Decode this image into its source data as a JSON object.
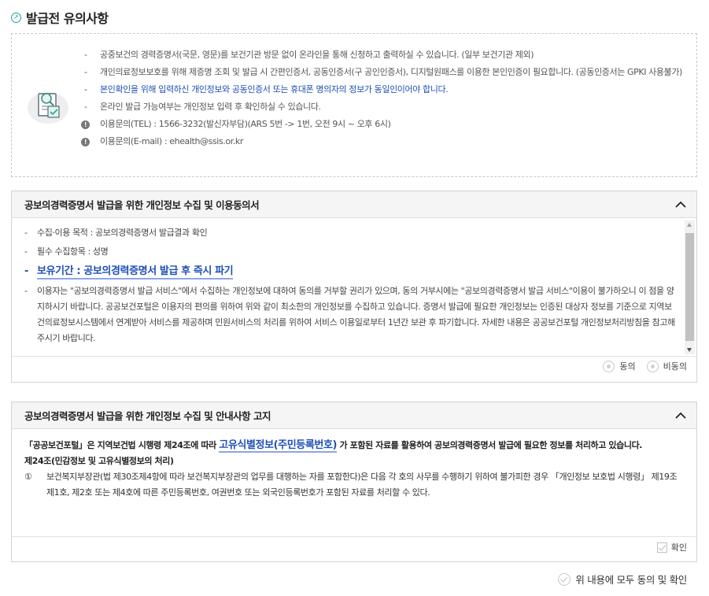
{
  "header": {
    "title": "발급전 유의사항",
    "icon": "compass-icon"
  },
  "notice": {
    "items": [
      "공중보건의 경력증명서(국문, 영문)를 보건기관 방문 없이 온라인을 통해 신청하고 출력하실 수 있습니다. (일부 보건기관 제외)",
      "개인의료정보보호를 위해 제증명 조회 및 발급 시 간편인증서, 공동인증서(구 공인인증서), 디지털원패스를 이용한 본인인증이 필요합니다. (공동인증서는 GPKI 사용불가)",
      "본인확인을 위해 입력하신 개인정보와 공동인증서 또는 휴대폰 명의자의 정보가 동일인이어야 합니다.",
      "온라인 발급 가능여부는 개인정보 입력 후 확인하실 수 있습니다."
    ],
    "contacts": [
      "이용문의(TEL) : 1566-3232(발신자부담)(ARS 5번 -> 1번, 오전 9시 ~ 오후 6시)",
      "이용문의(E-mail) : ehealth@ssis.or.kr"
    ],
    "dash": "-",
    "highlight_color": "#1f4fb5"
  },
  "consent": {
    "title": "공보의경력증명서 발급을 위한 개인정보 수집 및 이용동의서",
    "items": [
      "수집·이용 목적 : 공보의경력증명서 발급결과 확인",
      "필수 수집항목 : 성명",
      "보유기간 : 공보의경력증명서 발급 후 즉시 파기",
      "이용자는 \"공보의경력증명서 발급 서비스\"에서 수집하는 개인정보에 대하여 동의를 거부할 권리가 있으며, 동의 거부시에는 \"공보의경력증명서 발급 서비스\"이용이 불가하오니 이 점을 양지하시기 바랍니다. 공공보건포털은 이용자의 편의를 위하여 위와 같이 최소한의 개인정보를 수집하고 있습니다. 증명서 발급에 필요한 개인정보는 인증된 대상자 정보를 기준으로 지역보건의료정보시스템에서 연계받아 서비스를 제공하며 민원서비스의 처리를 위하여 서비스 이용일로부터 1년간 보관 후 파기합니다. 자세한 내용은 공공보건포털 개인정보처리방침을 참고해주시기 바랍니다."
    ],
    "agree_label": "동의",
    "disagree_label": "비동의"
  },
  "notice2": {
    "title": "공보의경력증명서 발급을 위한 개인정보 수집 및 안내사항 고지",
    "line1_pre": "「공공보건포털」은 지역보건법 시행령 제24조에 따라 ",
    "line1_hl": "고유식별정보(주민등록번호)",
    "line1_post": " 가 포함된 자료를 활용하여 공보의경력증명서 발급에 필요한 정보를 처리하고 있습니다.",
    "article": "제24조(민감정보 및 고유식별정보의 처리)",
    "clause_num": "①",
    "clause": "보건복지부장관(법 제30조제4항에 따라 보건복지부장관의 업무를 대행하는 자를 포함한다)은 다음 각 호의 사무를 수행하기 위하여 불가피한 경우 「개인정보 보호법 시행령」 제19조제1호, 제2호 또는 제4호에 따른 주민등록번호, 여권번호 또는 외국인등록번호가 포함된 자료를 처리할 수 있다.",
    "confirm_label": "확인"
  },
  "agree_all_label": "위 내용에 모두 동의 및 확인"
}
